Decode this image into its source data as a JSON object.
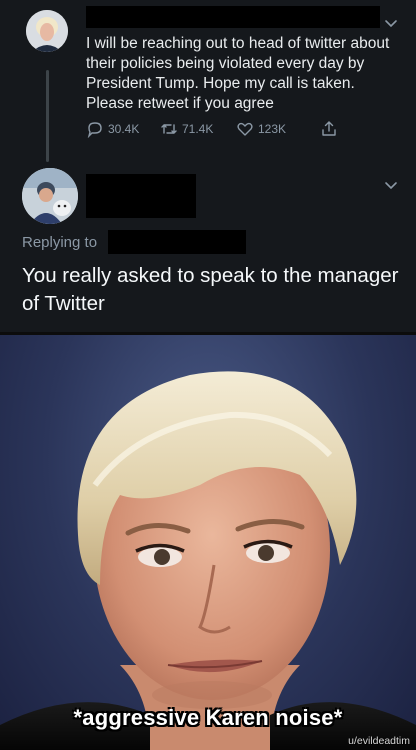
{
  "tweet": {
    "text": "I will be reaching out to head of twitter about their policies being violated every day by President Tump. Hope my call is taken. Please retweet if you agree",
    "replies": "30.4K",
    "retweets": "71.4K",
    "likes": "123K"
  },
  "reply": {
    "replying_to": "Replying to",
    "text": "You really asked to speak to the manager of Twitter"
  },
  "meme": {
    "caption": "*aggressive Karen noise*",
    "watermark": "u/evildeadtim"
  },
  "colors": {
    "tweet_bg": "#15181c",
    "muted_text": "#8b98a5",
    "redaction": "#000000"
  },
  "icons": [
    "reply-icon",
    "retweet-icon",
    "like-icon",
    "share-icon",
    "chevron-down-icon"
  ]
}
